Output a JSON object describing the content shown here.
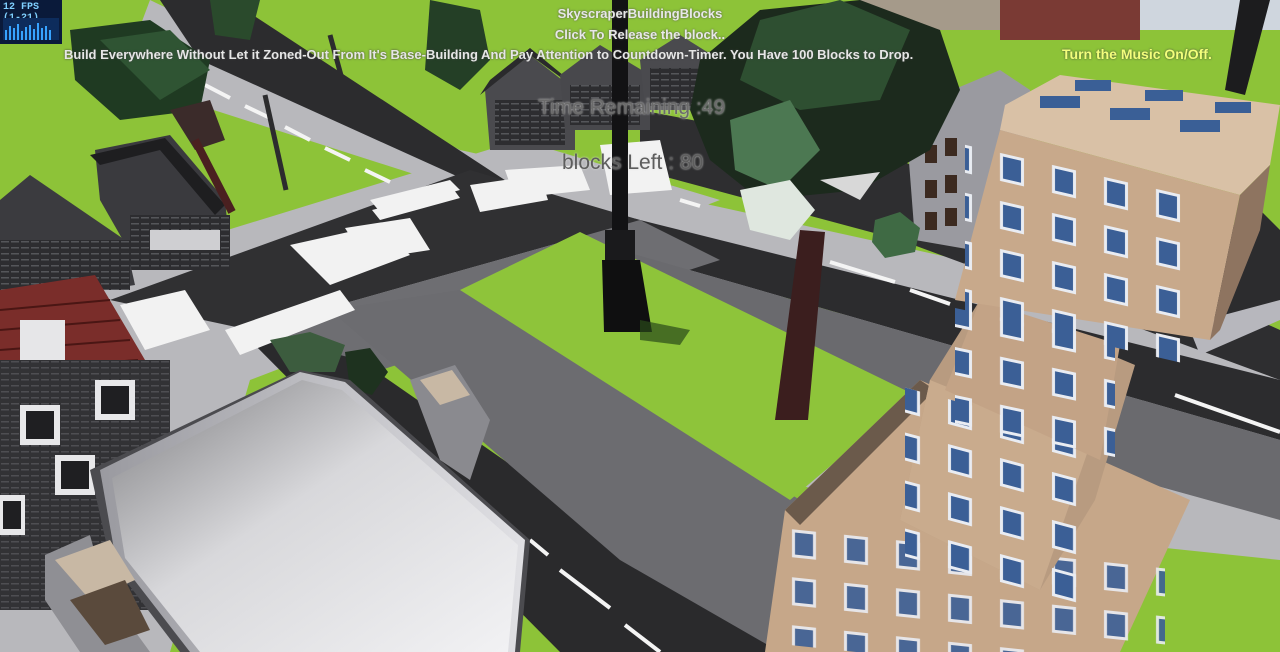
{
  "hud": {
    "fps_label": "12 FPS (1-21)",
    "title": "SkyscraperBuildingBlocks",
    "hint": "Click To Release the block..",
    "instructions": "Build Everywhere Without Let it Zoned-Out From It's Base-Building And Pay Attention to Countdown-Timer. You Have 100 Blocks to Drop.",
    "music_toggle": "Turn the Music On/Off.",
    "time_remaining": "Time Remaining :49",
    "blocks_left": "blocks Left : 80"
  },
  "colors": {
    "grass": "#8fc43a",
    "road": "#2b2b2b",
    "sidewalk": "#b9b9bd",
    "building_tan": "#c9a98a",
    "window_blue": "#3a5f96",
    "hud_text": "#e8e8e8",
    "music_link": "#f3ff7a"
  }
}
